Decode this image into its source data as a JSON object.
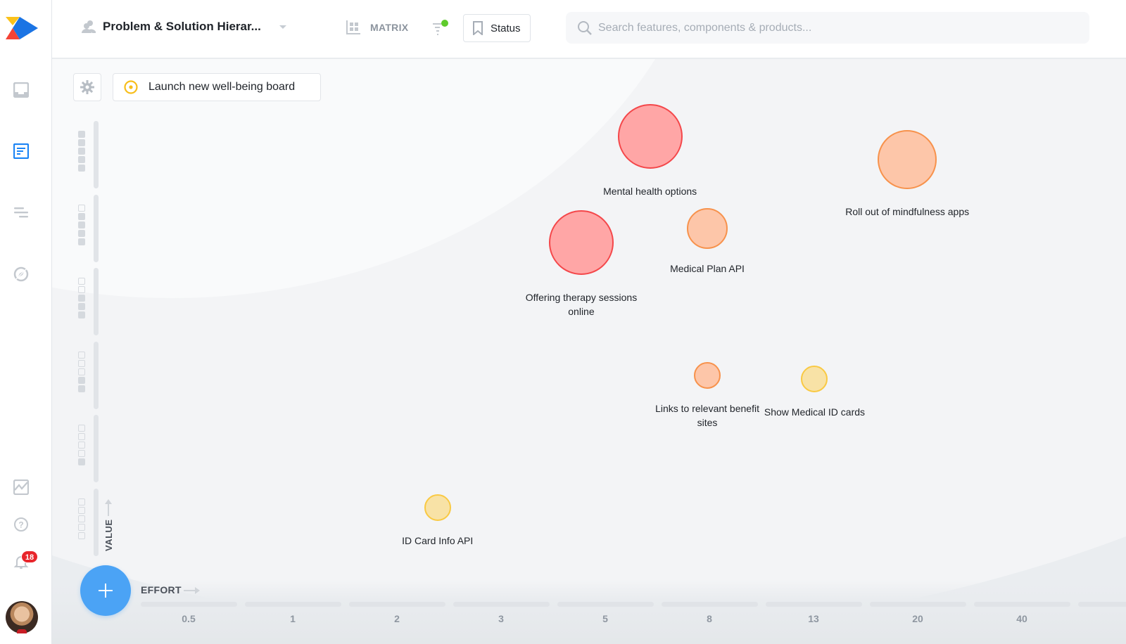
{
  "header": {
    "board_title": "Problem & Solution Hierar...",
    "view_label": "MATRIX",
    "status_label": "Status",
    "search_placeholder": "Search features, components & products...",
    "search_value": ""
  },
  "sidebar": {
    "items": [
      {
        "name": "inbox",
        "active": false
      },
      {
        "name": "board",
        "active": true
      },
      {
        "name": "roadmap",
        "active": false
      },
      {
        "name": "discover",
        "active": false
      }
    ],
    "bottom": [
      "analytics",
      "help",
      "notifications"
    ],
    "notification_count": "18",
    "accent": "#1b84f5"
  },
  "canvas": {
    "goal_label": "Launch new well-being board",
    "value_axis_label": "VALUE",
    "effort_axis_label": "EFFORT",
    "value_levels": [
      5,
      4,
      3,
      2,
      1,
      0
    ],
    "effort_ticks": [
      "0.5",
      "1",
      "2",
      "3",
      "5",
      "8",
      "13",
      "20",
      "40"
    ]
  },
  "chart_data": {
    "type": "scatter",
    "title": "",
    "xlabel": "EFFORT",
    "ylabel": "VALUE",
    "x_categories": [
      "0.5",
      "1",
      "2",
      "3",
      "5",
      "8",
      "13",
      "20",
      "40"
    ],
    "y_levels": [
      0,
      1,
      2,
      3,
      4,
      5
    ],
    "points": [
      {
        "label": "Mental health options",
        "effort_index": 4.43,
        "value": 5.25,
        "size": "large",
        "status": "red"
      },
      {
        "label": "Roll out of mindfulness apps",
        "effort_index": 6.9,
        "value": 4.93,
        "size": "medium-large",
        "status": "orange"
      },
      {
        "label": "Offering therapy sessions online",
        "effort_index": 3.77,
        "value": 3.8,
        "size": "large",
        "status": "red"
      },
      {
        "label": "Medical Plan API",
        "effort_index": 4.98,
        "value": 4.0,
        "size": "medium",
        "status": "orange"
      },
      {
        "label": "Links to relevant benefit sites",
        "effort_index": 4.98,
        "value": 2.0,
        "size": "small",
        "status": "orange"
      },
      {
        "label": "Show Medical ID cards",
        "effort_index": 6.01,
        "value": 1.95,
        "size": "small",
        "status": "yellow"
      },
      {
        "label": "ID Card Info API",
        "effort_index": 2.39,
        "value": 0.2,
        "size": "small",
        "status": "yellow"
      }
    ],
    "status_colors": {
      "red": {
        "fill": "#ffa6a6",
        "stroke": "#f4474a"
      },
      "orange": {
        "fill": "#fdc6a9",
        "stroke": "#f7924c"
      },
      "yellow": {
        "fill": "#f8e2a6",
        "stroke": "#f9c943"
      }
    }
  }
}
